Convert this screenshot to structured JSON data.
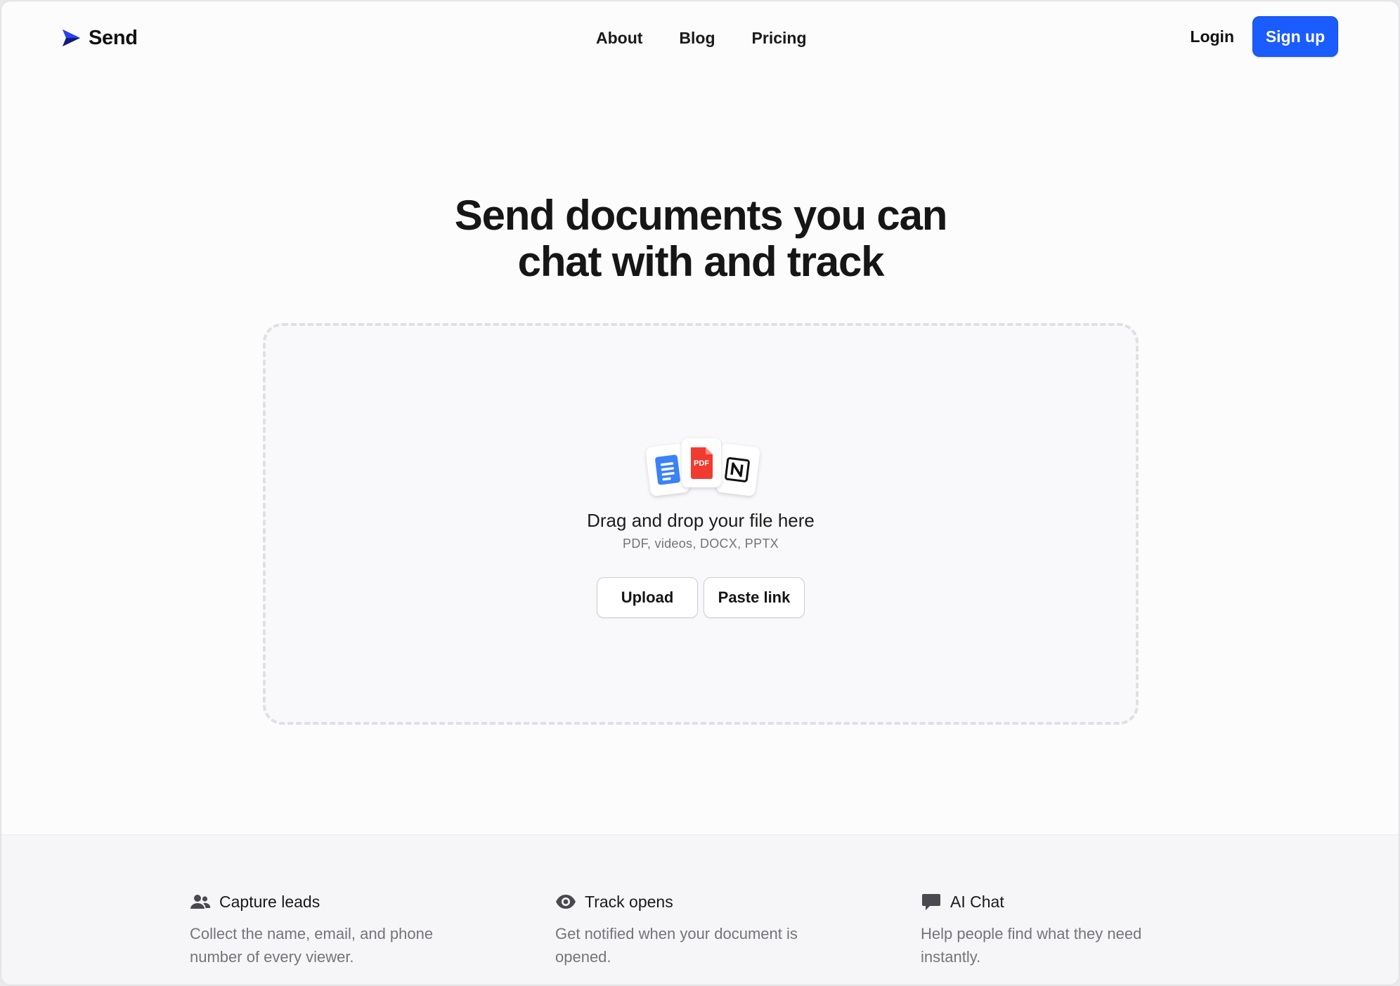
{
  "nav": {
    "logo_text": "Send",
    "links": [
      "About",
      "Blog",
      "Pricing"
    ],
    "login": "Login",
    "signup": "Sign up"
  },
  "hero": {
    "title_line1": "Send documents you can",
    "title_line2": "chat with and track"
  },
  "dropzone": {
    "title": "Drag and drop your file here",
    "subtitle": "PDF, videos, DOCX, PPTX",
    "upload_label": "Upload",
    "paste_label": "Paste link",
    "pdf_badge": "PDF"
  },
  "features": [
    {
      "icon": "users-icon",
      "title": "Capture leads",
      "description": "Collect the name, email, and phone number of every viewer."
    },
    {
      "icon": "eye-icon",
      "title": "Track opens",
      "description": "Get notified when your document is opened."
    },
    {
      "icon": "chat-bubble-icon",
      "title": "AI Chat",
      "description": "Help people find what they need instantly."
    }
  ],
  "colors": {
    "accent": "#1a5cff",
    "pdf_red": "#f23b30",
    "docs_blue": "#3b82f6"
  }
}
